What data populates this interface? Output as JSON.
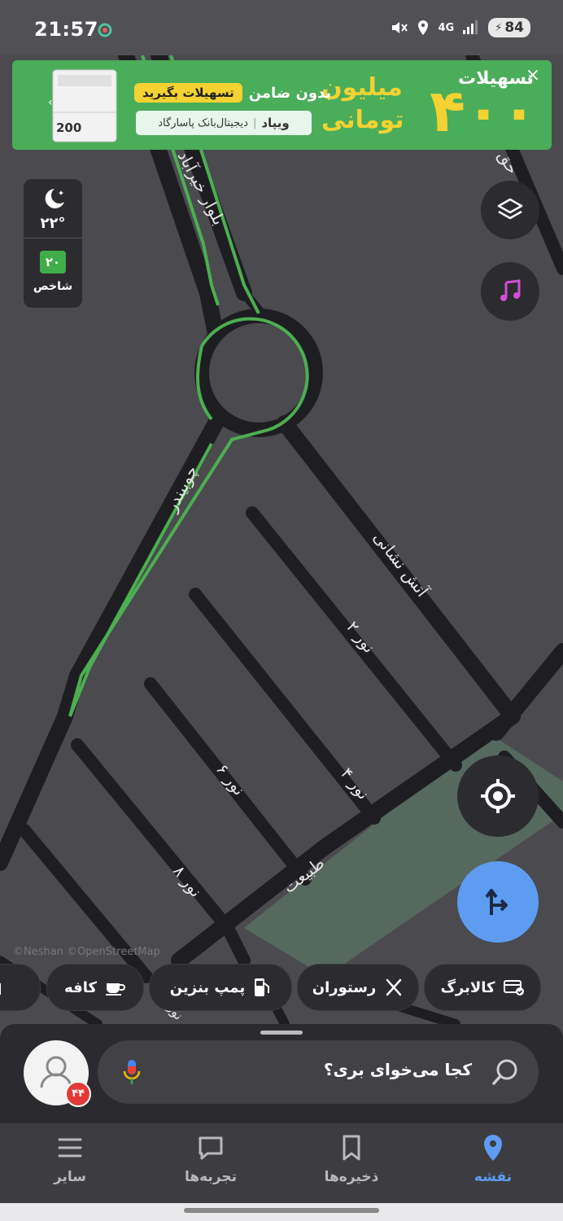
{
  "status_bar": {
    "time": "21:57",
    "network": "4G",
    "battery": "84",
    "icons": [
      "mute-icon",
      "location-icon",
      "signal-icon",
      "battery-icon"
    ]
  },
  "ad": {
    "headline_prefix": "تسهیلات",
    "amount": "۴۰۰",
    "unit_line1": "میلیون",
    "unit_line2": "تومانی",
    "guarantee_text": "بدون ضامن",
    "cta": "تسهیلات بگیرید",
    "brand": "ویپاد",
    "bank": "دیجیتال‌بانک پاسارگاد",
    "banknote_text": "200",
    "close": "×"
  },
  "weather": {
    "temperature": "۲۲°",
    "aqi_value": "۲۰",
    "aqi_label": "شاخص"
  },
  "map": {
    "labels": {
      "boulevard": "بلوار خیرآباد",
      "chobindar": "چوبیندر",
      "atash_neshani": "آتش نشانی",
      "noor2": "نور ۲",
      "noor4": "نور ۴",
      "noor6": "نور ۶",
      "noor8": "نور ۸",
      "tabiat": "طبیعت",
      "top_right": "حق",
      "bottom_left": "نور"
    },
    "attribution": "©Neshan ©OpenStreetMap",
    "route_color": "#4caf50",
    "road_color": "#1e1e22",
    "park_color": "#56695f"
  },
  "chips": [
    "کالابرگ",
    "رستوران",
    "پمپ بنزین",
    "کافه"
  ],
  "search": {
    "placeholder": "کجا می‌خوای بری؟",
    "notification_count": "۴۴"
  },
  "tabs": [
    {
      "label": "نقشه",
      "icon": "map-pin-icon",
      "active": true
    },
    {
      "label": "ذخیره‌ها",
      "icon": "bookmark-icon",
      "active": false
    },
    {
      "label": "تجربه‌ها",
      "icon": "chat-icon",
      "active": false
    },
    {
      "label": "سایر",
      "icon": "menu-icon",
      "active": false
    }
  ],
  "colors": {
    "accent": "#5e9cf2",
    "ad_green": "#4aad5a",
    "ad_yellow": "#f4d232",
    "badge_red": "#e53935",
    "music_purple": "#d14fd6"
  }
}
